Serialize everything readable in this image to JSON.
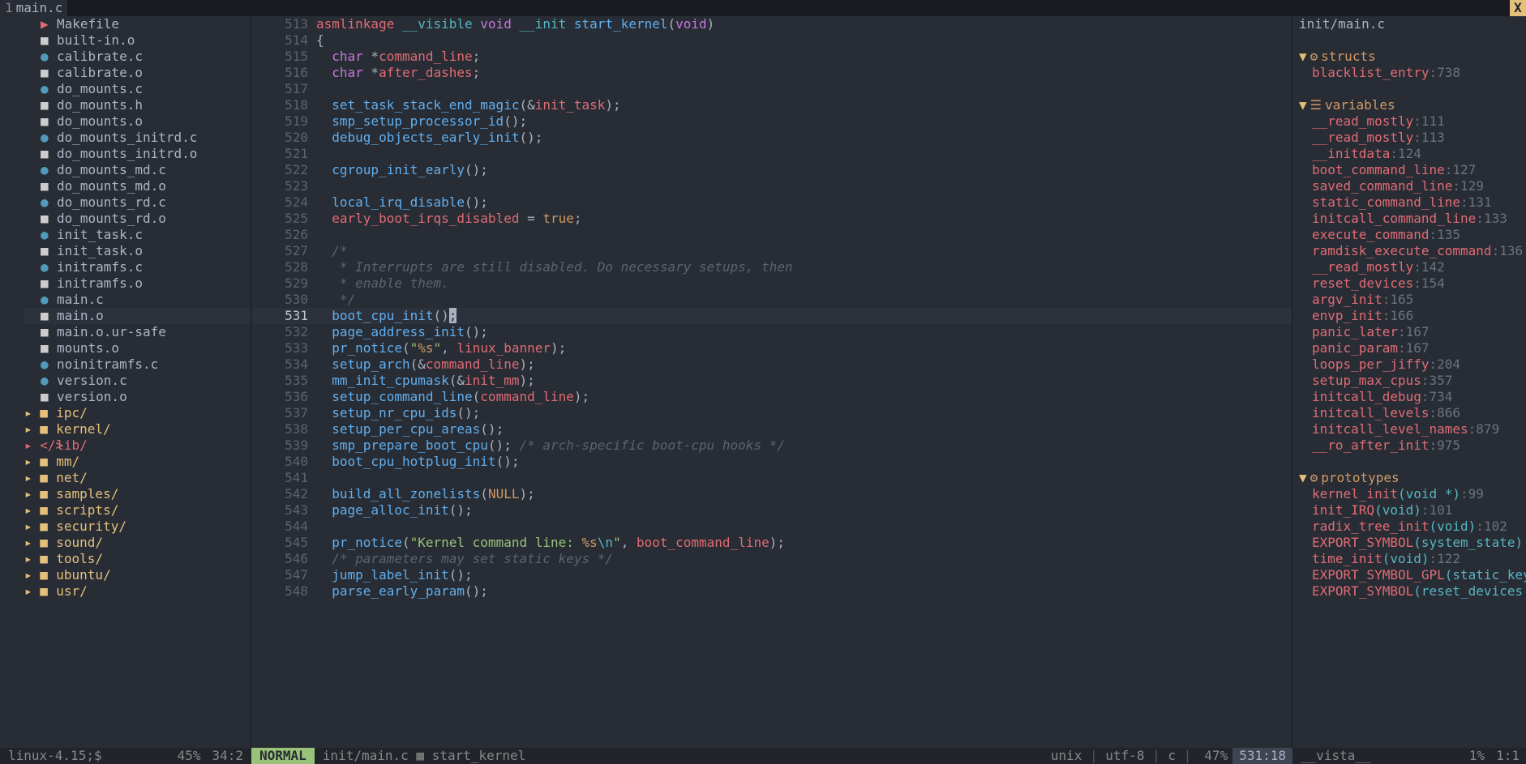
{
  "tabline": {
    "num": "1",
    "name": "main.c",
    "close": "X"
  },
  "nerdtree": {
    "items": [
      {
        "icon": "mk",
        "label": "Makefile",
        "t": "mk"
      },
      {
        "icon": "o",
        "label": "built-in.o",
        "t": "o"
      },
      {
        "icon": "c",
        "label": "calibrate.c",
        "t": "c"
      },
      {
        "icon": "o",
        "label": "calibrate.o",
        "t": "o"
      },
      {
        "icon": "c",
        "label": "do_mounts.c",
        "t": "c"
      },
      {
        "icon": "h",
        "label": "do_mounts.h",
        "t": "h"
      },
      {
        "icon": "o",
        "label": "do_mounts.o",
        "t": "o"
      },
      {
        "icon": "c",
        "label": "do_mounts_initrd.c",
        "t": "c"
      },
      {
        "icon": "o",
        "label": "do_mounts_initrd.o",
        "t": "o"
      },
      {
        "icon": "c",
        "label": "do_mounts_md.c",
        "t": "c"
      },
      {
        "icon": "o",
        "label": "do_mounts_md.o",
        "t": "o"
      },
      {
        "icon": "c",
        "label": "do_mounts_rd.c",
        "t": "c"
      },
      {
        "icon": "o",
        "label": "do_mounts_rd.o",
        "t": "o"
      },
      {
        "icon": "c",
        "label": "init_task.c",
        "t": "c"
      },
      {
        "icon": "o",
        "label": "init_task.o",
        "t": "o"
      },
      {
        "icon": "c",
        "label": "initramfs.c",
        "t": "c"
      },
      {
        "icon": "o",
        "label": "initramfs.o",
        "t": "o"
      },
      {
        "icon": "c",
        "label": "main.c",
        "t": "c"
      },
      {
        "icon": "o",
        "label": "main.o",
        "t": "o",
        "sel": true
      },
      {
        "icon": "o",
        "label": "main.o.ur-safe",
        "t": "o"
      },
      {
        "icon": "o",
        "label": "mounts.o",
        "t": "o"
      },
      {
        "icon": "c",
        "label": "noinitramfs.c",
        "t": "c"
      },
      {
        "icon": "c",
        "label": "version.c",
        "t": "c"
      },
      {
        "icon": "o",
        "label": "version.o",
        "t": "o"
      },
      {
        "icon": "dir",
        "label": "ipc/",
        "t": "dir",
        "d": -1
      },
      {
        "icon": "dir",
        "label": "kernel/",
        "t": "dir",
        "d": -1
      },
      {
        "icon": "lib",
        "label": "lib/",
        "t": "lib",
        "d": -1
      },
      {
        "icon": "dir",
        "label": "mm/",
        "t": "dir",
        "d": -1
      },
      {
        "icon": "dir",
        "label": "net/",
        "t": "dir",
        "d": -1
      },
      {
        "icon": "dir",
        "label": "samples/",
        "t": "dir",
        "d": -1
      },
      {
        "icon": "dir",
        "label": "scripts/",
        "t": "dir",
        "d": -1
      },
      {
        "icon": "dir",
        "label": "security/",
        "t": "dir",
        "d": -1
      },
      {
        "icon": "dir",
        "label": "sound/",
        "t": "dir",
        "d": -1
      },
      {
        "icon": "dir",
        "label": "tools/",
        "t": "dir",
        "d": -1
      },
      {
        "icon": "dir",
        "label": "ubuntu/",
        "t": "dir",
        "d": -1
      },
      {
        "icon": "dir",
        "label": "usr/",
        "t": "dir",
        "d": -1
      }
    ],
    "icons": {
      "c": "●",
      "o": "■",
      "h": "■",
      "mk": "▶",
      "dir": "■",
      "lib": "</>"
    }
  },
  "editor": {
    "start": 513,
    "current": 531,
    "lines": [
      {
        "n": 513,
        "toks": [
          [
            "word",
            "asmlinkage "
          ],
          [
            "sig",
            "__visible "
          ],
          [
            "type",
            "void "
          ],
          [
            "sig",
            "__init "
          ],
          [
            "fn",
            "start_kernel"
          ],
          [
            "op",
            "("
          ],
          [
            "type",
            "void"
          ],
          [
            "op",
            ")"
          ]
        ]
      },
      {
        "n": 514,
        "toks": [
          [
            "op",
            "{"
          ]
        ]
      },
      {
        "n": 515,
        "toks": [
          [
            "op",
            "  "
          ],
          [
            "type",
            "char"
          ],
          [
            "op",
            " *"
          ],
          [
            "word",
            "command_line"
          ],
          [
            "op",
            ";"
          ]
        ]
      },
      {
        "n": 516,
        "toks": [
          [
            "op",
            "  "
          ],
          [
            "type",
            "char"
          ],
          [
            "op",
            " *"
          ],
          [
            "word",
            "after_dashes"
          ],
          [
            "op",
            ";"
          ]
        ]
      },
      {
        "n": 517,
        "toks": []
      },
      {
        "n": 518,
        "toks": [
          [
            "op",
            "  "
          ],
          [
            "fn",
            "set_task_stack_end_magic"
          ],
          [
            "op",
            "(&"
          ],
          [
            "word",
            "init_task"
          ],
          [
            "op",
            ");"
          ]
        ]
      },
      {
        "n": 519,
        "toks": [
          [
            "op",
            "  "
          ],
          [
            "fn",
            "smp_setup_processor_id"
          ],
          [
            "op",
            "();"
          ]
        ]
      },
      {
        "n": 520,
        "toks": [
          [
            "op",
            "  "
          ],
          [
            "fn",
            "debug_objects_early_init"
          ],
          [
            "op",
            "();"
          ]
        ]
      },
      {
        "n": 521,
        "toks": []
      },
      {
        "n": 522,
        "toks": [
          [
            "op",
            "  "
          ],
          [
            "fn",
            "cgroup_init_early"
          ],
          [
            "op",
            "();"
          ]
        ]
      },
      {
        "n": 523,
        "toks": []
      },
      {
        "n": 524,
        "toks": [
          [
            "op",
            "  "
          ],
          [
            "fn",
            "local_irq_disable"
          ],
          [
            "op",
            "();"
          ]
        ]
      },
      {
        "n": 525,
        "toks": [
          [
            "op",
            "  "
          ],
          [
            "word",
            "early_boot_irqs_disabled"
          ],
          [
            "op",
            " = "
          ],
          [
            "const",
            "true"
          ],
          [
            "op",
            ";"
          ]
        ]
      },
      {
        "n": 526,
        "toks": []
      },
      {
        "n": 527,
        "toks": [
          [
            "op",
            "  "
          ],
          [
            "cmt",
            "/*"
          ]
        ]
      },
      {
        "n": 528,
        "toks": [
          [
            "op",
            "  "
          ],
          [
            "cmt",
            " * Interrupts are still disabled. Do necessary setups, then"
          ]
        ]
      },
      {
        "n": 529,
        "toks": [
          [
            "op",
            "  "
          ],
          [
            "cmt",
            " * enable them."
          ]
        ]
      },
      {
        "n": 530,
        "toks": [
          [
            "op",
            "  "
          ],
          [
            "cmt",
            " */"
          ]
        ]
      },
      {
        "n": 531,
        "toks": [
          [
            "op",
            "  "
          ],
          [
            "fn",
            "boot_cpu_init"
          ],
          [
            "op",
            "()"
          ],
          [
            "cursor",
            ";"
          ]
        ]
      },
      {
        "n": 532,
        "toks": [
          [
            "op",
            "  "
          ],
          [
            "fn",
            "page_address_init"
          ],
          [
            "op",
            "();"
          ]
        ]
      },
      {
        "n": 533,
        "toks": [
          [
            "op",
            "  "
          ],
          [
            "fn",
            "pr_notice"
          ],
          [
            "op",
            "("
          ],
          [
            "str",
            "\""
          ],
          [
            "fmt",
            "%s"
          ],
          [
            "str",
            "\""
          ],
          [
            "op",
            ", "
          ],
          [
            "word",
            "linux_banner"
          ],
          [
            "op",
            ");"
          ]
        ]
      },
      {
        "n": 534,
        "toks": [
          [
            "op",
            "  "
          ],
          [
            "fn",
            "setup_arch"
          ],
          [
            "op",
            "(&"
          ],
          [
            "word",
            "command_line"
          ],
          [
            "op",
            ");"
          ]
        ]
      },
      {
        "n": 535,
        "toks": [
          [
            "op",
            "  "
          ],
          [
            "fn",
            "mm_init_cpumask"
          ],
          [
            "op",
            "(&"
          ],
          [
            "word",
            "init_mm"
          ],
          [
            "op",
            ");"
          ]
        ]
      },
      {
        "n": 536,
        "toks": [
          [
            "op",
            "  "
          ],
          [
            "fn",
            "setup_command_line"
          ],
          [
            "op",
            "("
          ],
          [
            "word",
            "command_line"
          ],
          [
            "op",
            ");"
          ]
        ]
      },
      {
        "n": 537,
        "toks": [
          [
            "op",
            "  "
          ],
          [
            "fn",
            "setup_nr_cpu_ids"
          ],
          [
            "op",
            "();"
          ]
        ]
      },
      {
        "n": 538,
        "toks": [
          [
            "op",
            "  "
          ],
          [
            "fn",
            "setup_per_cpu_areas"
          ],
          [
            "op",
            "();"
          ]
        ]
      },
      {
        "n": 539,
        "toks": [
          [
            "op",
            "  "
          ],
          [
            "fn",
            "smp_prepare_boot_cpu"
          ],
          [
            "op",
            "(); "
          ],
          [
            "cmt",
            "/* arch-specific boot-cpu hooks */"
          ]
        ]
      },
      {
        "n": 540,
        "toks": [
          [
            "op",
            "  "
          ],
          [
            "fn",
            "boot_cpu_hotplug_init"
          ],
          [
            "op",
            "();"
          ]
        ]
      },
      {
        "n": 541,
        "toks": []
      },
      {
        "n": 542,
        "toks": [
          [
            "op",
            "  "
          ],
          [
            "fn",
            "build_all_zonelists"
          ],
          [
            "op",
            "("
          ],
          [
            "const",
            "NULL"
          ],
          [
            "op",
            ");"
          ]
        ]
      },
      {
        "n": 543,
        "toks": [
          [
            "op",
            "  "
          ],
          [
            "fn",
            "page_alloc_init"
          ],
          [
            "op",
            "();"
          ]
        ]
      },
      {
        "n": 544,
        "toks": []
      },
      {
        "n": 545,
        "toks": [
          [
            "op",
            "  "
          ],
          [
            "fn",
            "pr_notice"
          ],
          [
            "op",
            "("
          ],
          [
            "str",
            "\"Kernel command line: "
          ],
          [
            "fmt",
            "%s"
          ],
          [
            "esc",
            "\\n"
          ],
          [
            "str",
            "\""
          ],
          [
            "op",
            ", "
          ],
          [
            "word",
            "boot_command_line"
          ],
          [
            "op",
            ");"
          ]
        ]
      },
      {
        "n": 546,
        "toks": [
          [
            "op",
            "  "
          ],
          [
            "cmt",
            "/* parameters may set static keys */"
          ]
        ]
      },
      {
        "n": 547,
        "toks": [
          [
            "op",
            "  "
          ],
          [
            "fn",
            "jump_label_init"
          ],
          [
            "op",
            "();"
          ]
        ]
      },
      {
        "n": 548,
        "toks": [
          [
            "op",
            "  "
          ],
          [
            "fn",
            "parse_early_param"
          ],
          [
            "op",
            "();"
          ]
        ]
      }
    ]
  },
  "vista": {
    "title": "init/main.c",
    "sections": [
      {
        "label": "structs",
        "ico": "⚙",
        "items": [
          {
            "n": "blacklist_entry",
            "l": "738"
          }
        ]
      },
      {
        "label": "variables",
        "ico": "☰",
        "items": [
          {
            "n": "__read_mostly",
            "l": "111"
          },
          {
            "n": "__read_mostly",
            "l": "113"
          },
          {
            "n": "__initdata",
            "l": "124"
          },
          {
            "n": "boot_command_line",
            "l": "127"
          },
          {
            "n": "saved_command_line",
            "l": "129"
          },
          {
            "n": "static_command_line",
            "l": "131"
          },
          {
            "n": "initcall_command_line",
            "l": "133"
          },
          {
            "n": "execute_command",
            "l": "135"
          },
          {
            "n": "ramdisk_execute_command",
            "l": "136"
          },
          {
            "n": "__read_mostly",
            "l": "142"
          },
          {
            "n": "reset_devices",
            "l": "154"
          },
          {
            "n": "argv_init",
            "l": "165"
          },
          {
            "n": "envp_init",
            "l": "166"
          },
          {
            "n": "panic_later",
            "l": "167"
          },
          {
            "n": "panic_param",
            "l": "167"
          },
          {
            "n": "loops_per_jiffy",
            "l": "204"
          },
          {
            "n": "setup_max_cpus",
            "l": "357"
          },
          {
            "n": "initcall_debug",
            "l": "734"
          },
          {
            "n": "initcall_levels",
            "l": "866"
          },
          {
            "n": "initcall_level_names",
            "l": "879"
          },
          {
            "n": "__ro_after_init",
            "l": "975"
          }
        ]
      },
      {
        "label": "prototypes",
        "ico": "⚙",
        "items": [
          {
            "n": "kernel_init",
            "p": "(void *)",
            "l": "99"
          },
          {
            "n": "init_IRQ",
            "p": "(void)",
            "l": "101"
          },
          {
            "n": "radix_tree_init",
            "p": "(void)",
            "l": "102"
          },
          {
            "n": "EXPORT_SYMBOL",
            "p": "(system_state)",
            "l": ""
          },
          {
            "n": "time_init",
            "p": "(void)",
            "l": "122"
          },
          {
            "n": "EXPORT_SYMBOL_GPL",
            "p": "(static_key",
            "l": ""
          },
          {
            "n": "EXPORT_SYMBOL",
            "p": "(reset_devices",
            "l": ""
          }
        ]
      }
    ]
  },
  "status": {
    "nerd": {
      "path": "linux-4.15;$",
      "pct": "45%",
      "pos": "34:2"
    },
    "editor": {
      "mode": "NORMAL",
      "file": "init/main.c",
      "func": "start_kernel",
      "enc": "unix",
      "fenc": "utf-8",
      "ft": "c",
      "pct": "47%",
      "pos": "531:18"
    },
    "vista": {
      "name": "__vista__",
      "pct": "1%",
      "pos": "1:1"
    }
  }
}
